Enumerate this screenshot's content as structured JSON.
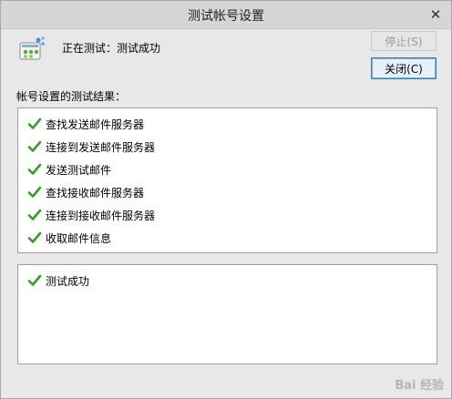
{
  "window": {
    "title": "测试帐号设置",
    "close_glyph": "✕"
  },
  "status": {
    "text": "正在测试：测试成功"
  },
  "buttons": {
    "stop_label": "停止(S)",
    "close_label": "关闭(C)"
  },
  "results": {
    "heading": "帐号设置的测试结果：",
    "items": [
      {
        "label": "查找发送邮件服务器",
        "icon": "check-icon"
      },
      {
        "label": "连接到发送邮件服务器",
        "icon": "check-icon"
      },
      {
        "label": "发送测试邮件",
        "icon": "check-icon"
      },
      {
        "label": "查找接收邮件服务器",
        "icon": "check-icon"
      },
      {
        "label": "连接到接收邮件服务器",
        "icon": "check-icon"
      },
      {
        "label": "收取邮件信息",
        "icon": "check-icon"
      }
    ]
  },
  "summary": {
    "items": [
      {
        "label": "测试成功",
        "icon": "check-icon"
      }
    ]
  },
  "watermark": {
    "text": "Bai 经验"
  },
  "colors": {
    "check": "#3a9a2c",
    "titlebar": "#d6d6d6",
    "background": "#e8e8e8"
  }
}
